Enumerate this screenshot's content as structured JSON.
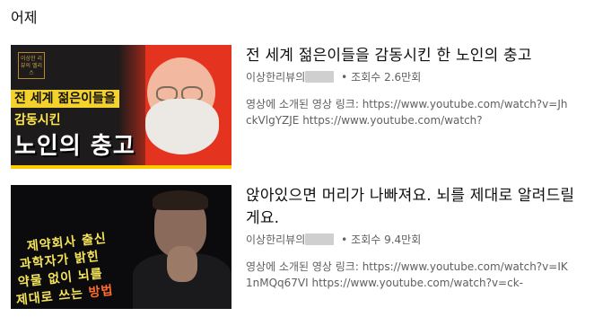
{
  "section": {
    "title": "어제"
  },
  "videos": [
    {
      "title": "전 세계 젊은이들을 감동시킨 한 노인의 충고",
      "channel": "이상한리뷰의",
      "separator": "•",
      "views": "조회수 2.6만회",
      "description": "영상에 소개된 영상 링크: https://www.youtube.com/watch?v=JhckVlgYZJE https://www.youtube.com/watch?",
      "thumbnail": {
        "logo_text": "이상한 리뷰의 멜리스",
        "line1": "전 세계 젊은이들을",
        "line2": "감동시킨",
        "line3": "노인의 충고"
      }
    },
    {
      "title": "앉아있으면 머리가 나빠져요. 뇌를 제대로 알려드릴게요.",
      "channel": "이상한리뷰의",
      "separator": "•",
      "views": "조회수 9.4만회",
      "description": "영상에 소개된 영상 링크: https://www.youtube.com/watch?v=IK1nMQq67VI https://www.youtube.com/watch?v=ck-",
      "thumbnail": {
        "line1": "제약회사 출신",
        "line2": "과학자가 밝힌",
        "line3": "약물 없이 뇌를",
        "line4a": "제대로 쓰는 ",
        "line4b": "방법"
      }
    }
  ],
  "colors": {
    "title": "#0f0f0f",
    "meta": "#606060",
    "thumb1_accent": "#f3d22c",
    "thumb1_red": "#e4331f",
    "thumb2_text": "#f4e35a",
    "thumb2_accent": "#ff6b2d"
  }
}
